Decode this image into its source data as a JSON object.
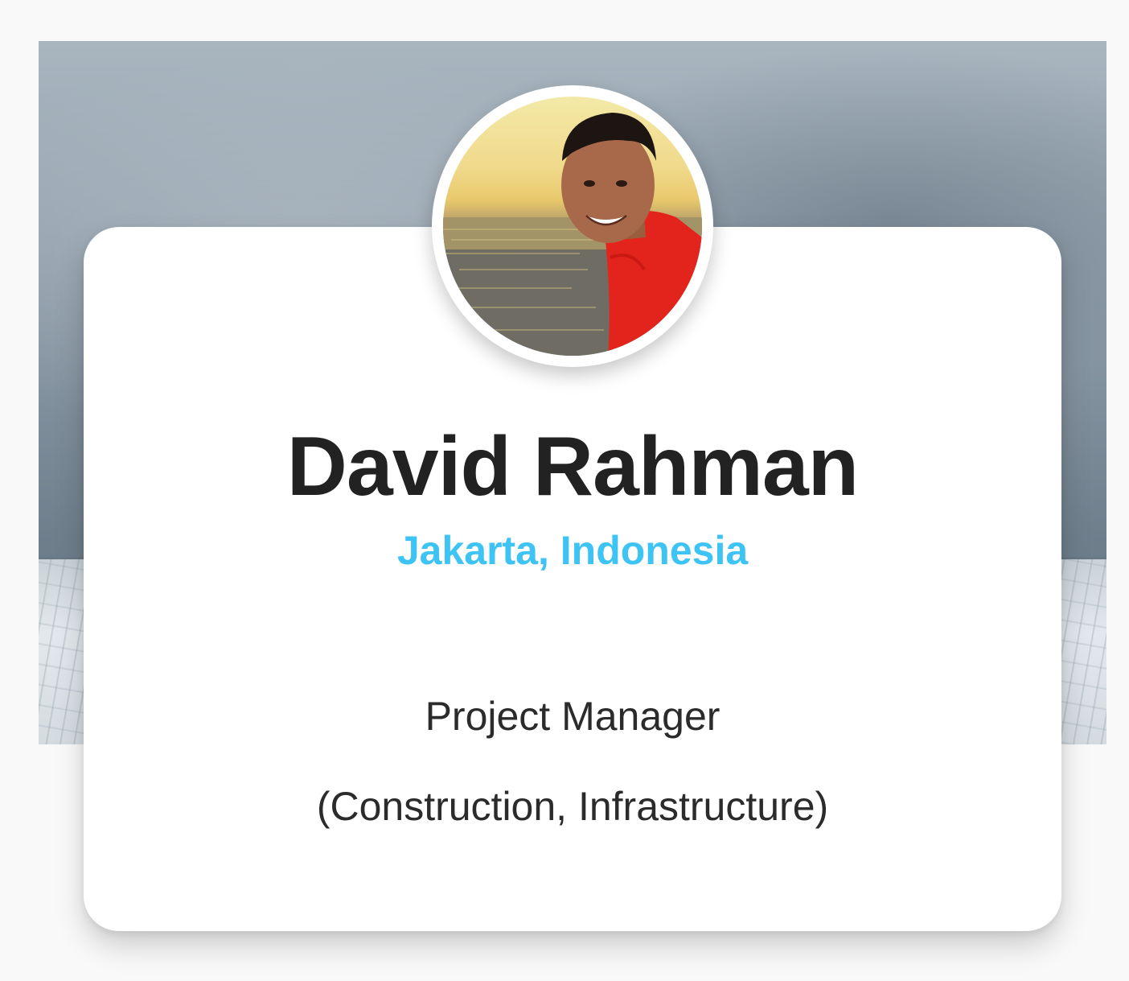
{
  "profile": {
    "name": "David Rahman",
    "location": "Jakarta, Indonesia",
    "role": "Project Manager",
    "field": "(Construction, Infrastructure)"
  },
  "colors": {
    "location_accent": "#3ec3f5",
    "name_text": "#222222",
    "body_text": "#2b2b2b",
    "card_background": "#ffffff",
    "page_background": "#f9f9f9"
  },
  "images": {
    "cover": "cloudy-sky-cover-image",
    "avatar": "profile-photo"
  }
}
